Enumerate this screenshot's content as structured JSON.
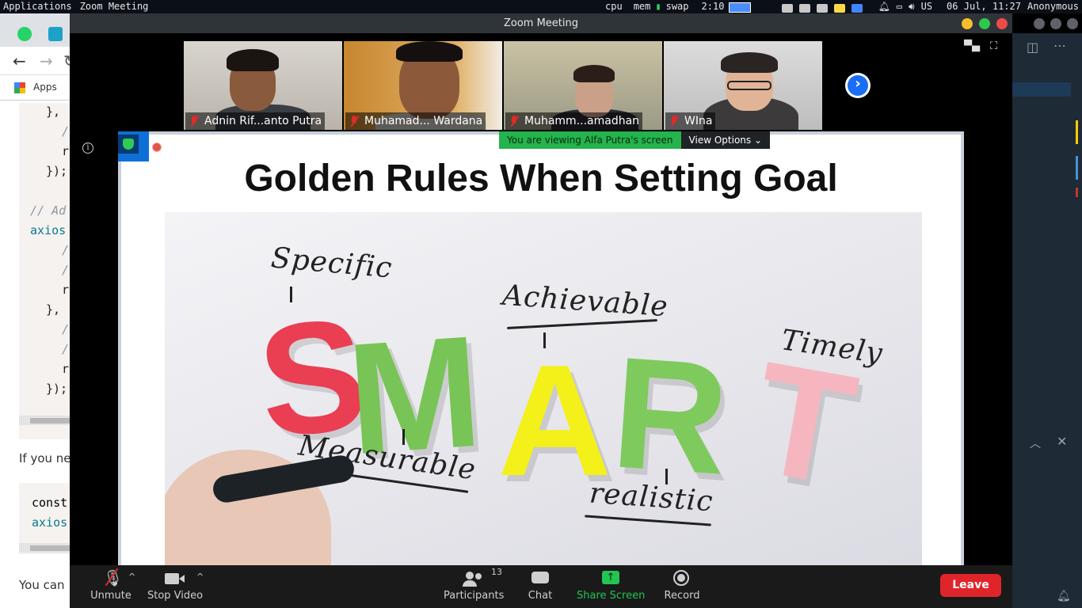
{
  "topbar": {
    "applications": "Applications",
    "active_app": "Zoom Meeting",
    "cpu": "cpu",
    "mem": "mem",
    "swap": "swap",
    "workspace": "2:10",
    "keyboard": "US",
    "datetime": "06 Jul, 11:27",
    "user": "Anonymous"
  },
  "browser": {
    "bookmarks_apps": "Apps",
    "code_lines": [
      "},",
      "/",
      "r",
      "});",
      "// Ad",
      "axios",
      "/",
      "/",
      "r",
      "},",
      "/",
      "/",
      "r",
      "});"
    ],
    "para1": "If you ne",
    "code2_lines": [
      "const",
      "axios"
    ],
    "para2": "You can"
  },
  "zoom": {
    "window_title": "Zoom Meeting",
    "participants": [
      {
        "name": "Adnin Rif...anto Putra"
      },
      {
        "name": "Muhamad... Wardana"
      },
      {
        "name": "Muhamm...amadhan"
      },
      {
        "name": "WIna"
      }
    ],
    "viewing_banner": "You are viewing Alfa Putra's screen",
    "view_options": "View Options",
    "info_icon": "i",
    "slide": {
      "title": "Golden Rules When Setting Goal",
      "words": {
        "specific": "Specific",
        "achievable": "Achievable",
        "timely": "Timely",
        "measurable": "Measurable",
        "realistic": "realistic"
      },
      "letters": [
        "S",
        "M",
        "A",
        "R",
        "T"
      ],
      "letter_colors": [
        "#ea3e52",
        "#78c456",
        "#f4f01a",
        "#7fca5c",
        "#f6b6c0"
      ]
    },
    "toolbar": {
      "unmute": "Unmute",
      "stop_video": "Stop Video",
      "participants": "Participants",
      "participants_count": "13",
      "chat": "Chat",
      "share_screen": "Share Screen",
      "record": "Record",
      "leave": "Leave"
    }
  },
  "colors": {
    "share_green": "#23c552",
    "leave_red": "#e0252a",
    "zoom_blue": "#1a6df5"
  }
}
